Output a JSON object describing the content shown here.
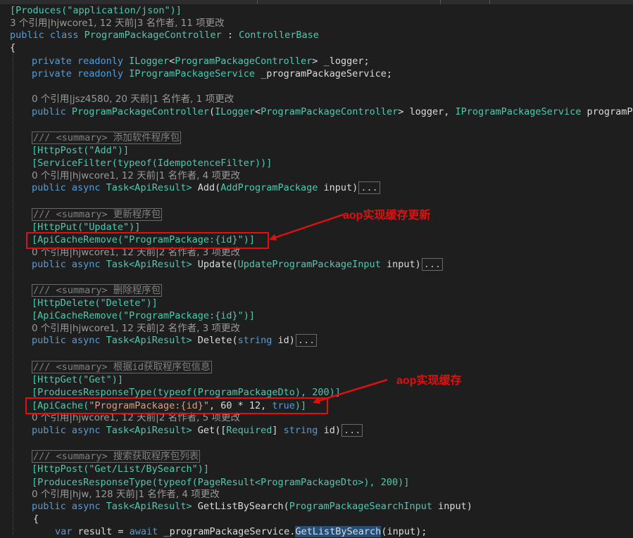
{
  "header": {
    "produces_attr": "[Produces(\"application/json\")]"
  },
  "codelens": {
    "class": "3 个引用|hjwcore1, 12 天前|3 名作者, 11 项更改",
    "ctor": "0 个引用|jsz4580, 20 天前|1 名作者, 1 项更改",
    "add": "0 个引用|hjwcore1, 12 天前|1 名作者, 4 项更改",
    "update": "0 个引用|hjwcore1, 12 天前|2 名作者, 3 项更改",
    "delete": "0 个引用|hjwcore1, 12 天前|2 名作者, 3 项更改",
    "get": "0 个引用|hjwcore1, 12 天前|2 名作者, 5 项更改",
    "search": "0 个引用|hjw, 128 天前|1 名作者, 4 项更改"
  },
  "class_decl": {
    "kw": "public class ",
    "name": "ProgramPackageController",
    "sep": " : ",
    "base": "ControllerBase"
  },
  "fields": {
    "logger": {
      "kw": "private readonly ",
      "type": "ILogger",
      "lt": "<",
      "arg": "ProgramPackageController",
      "gt": ">",
      "name": " _logger;"
    },
    "service": {
      "kw": "private readonly ",
      "type": "IProgramPackageService",
      "name": " _programPackageService;"
    }
  },
  "ctor": {
    "kw": "public ",
    "name": "ProgramPackageController",
    "open": "(",
    "t1": "ILogger",
    "lt": "<",
    "t1arg": "ProgramPackageController",
    "gt": ">",
    "p1": " logger, ",
    "t2": "IProgramPackageService",
    "p2": " programPac"
  },
  "methods": {
    "add": {
      "summary_tag": "/// <summary>",
      "summary_text": " 添加软件程序包",
      "attrs": [
        "[HttpPost(\"Add\")]",
        "[ServiceFilter(typeof(IdempotenceFilter))]"
      ],
      "sig_kw": "public async ",
      "sig_ret": "Task<ApiResult>",
      "sig_name": " Add(",
      "sig_ptype": "AddProgramPackage",
      "sig_pname": " input)"
    },
    "update": {
      "summary_tag": "/// <summary>",
      "summary_text": " 更新程序包",
      "attrs": [
        "[HttpPut(\"Update\")]",
        "[ApiCacheRemove(\"ProgramPackage:{id}\")]"
      ],
      "sig_kw": "public async ",
      "sig_ret": "Task<ApiResult>",
      "sig_name": " Update(",
      "sig_ptype": "UpdateProgramPackageInput",
      "sig_pname": " input)"
    },
    "delete": {
      "summary_tag": "/// <summary>",
      "summary_text": " 删除程序包",
      "attrs": [
        "[HttpDelete(\"Delete\")]",
        "[ApiCacheRemove(\"ProgramPackage:{id}\")]"
      ],
      "sig_kw": "public async ",
      "sig_ret": "Task<ApiResult>",
      "sig_name": " Delete(",
      "sig_ptype": "string",
      "sig_pname": " id)"
    },
    "get": {
      "summary_tag": "/// <summary>",
      "summary_text": " 根据id获取程序包信息",
      "attrs": [
        "[HttpGet(\"Get\")]",
        "[ProducesResponseType(typeof(ProgramPackageDto), 200)]"
      ],
      "cache_attr": {
        "open": "[ApiCache(",
        "key": "\"ProgramPackage:{id}\"",
        "mid": ", 60 * 12, ",
        "flag": "true",
        "close": ")]"
      },
      "sig_kw": "public async ",
      "sig_ret": "Task<ApiResult>",
      "sig_name": " Get([",
      "sig_req": "Required",
      "sig_close": "] ",
      "sig_ptype": "string",
      "sig_pname": " id)"
    },
    "search": {
      "summary_tag": "/// <summary>",
      "summary_text": " 搜索获取程序包列表",
      "attrs": [
        "[HttpPost(\"Get/List/BySearch\")]",
        "[ProducesResponseType(typeof(PageResult<ProgramPackageDto>), 200)]"
      ],
      "sig_kw": "public async ",
      "sig_ret": "Task<ApiResult>",
      "sig_name": " GetListBySearch(",
      "sig_ptype": "ProgramPackageSearchInput",
      "sig_pname": " input)"
    }
  },
  "body": {
    "open_brace": "{",
    "var_kw": "var ",
    "var_rest": "result = ",
    "await_kw": "await",
    "call_pre": " _programPackageService.",
    "call_hl": "GetListBySearch",
    "call_post": "(input);"
  },
  "fold_label": "...",
  "class_open_brace": "{",
  "annotations": {
    "cache_update": "aop实现缓存更新",
    "cache": "aop实现缓存"
  },
  "colors": {
    "keyword": "#569cd6",
    "type": "#4ec9b0",
    "string": "#d69d85",
    "annotation": "#e01010"
  }
}
